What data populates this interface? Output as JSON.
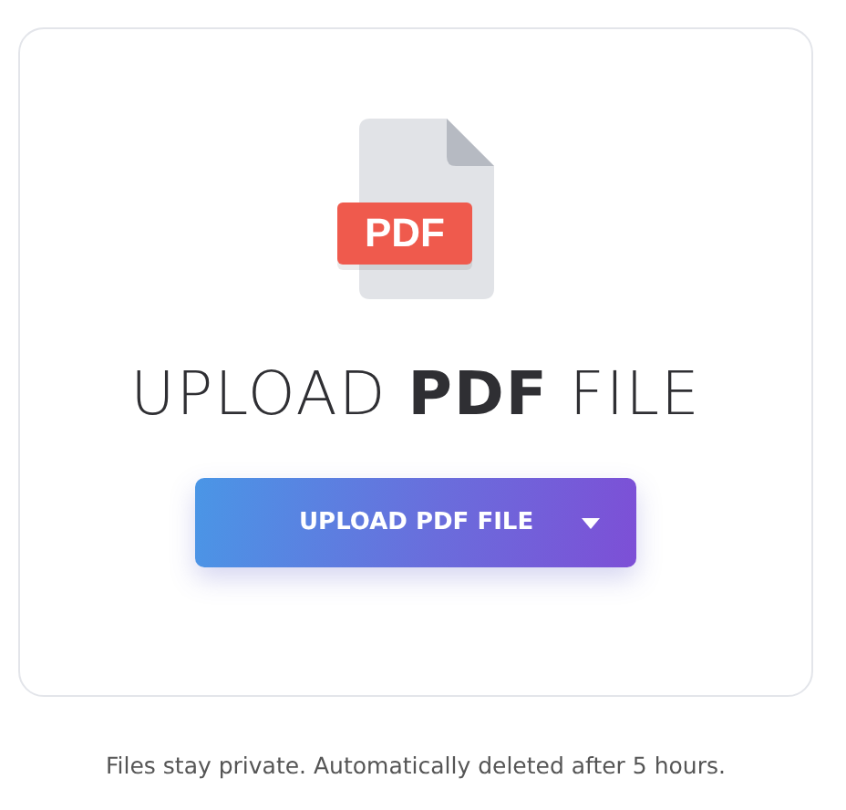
{
  "upload_card": {
    "file_badge": "PDF",
    "heading": "UPLOAD **PDF** FILE",
    "upload_button": {
      "label": "UPLOAD PDF FILE"
    }
  },
  "footer_note": "Files stay private. Automatically deleted after 5 hours."
}
